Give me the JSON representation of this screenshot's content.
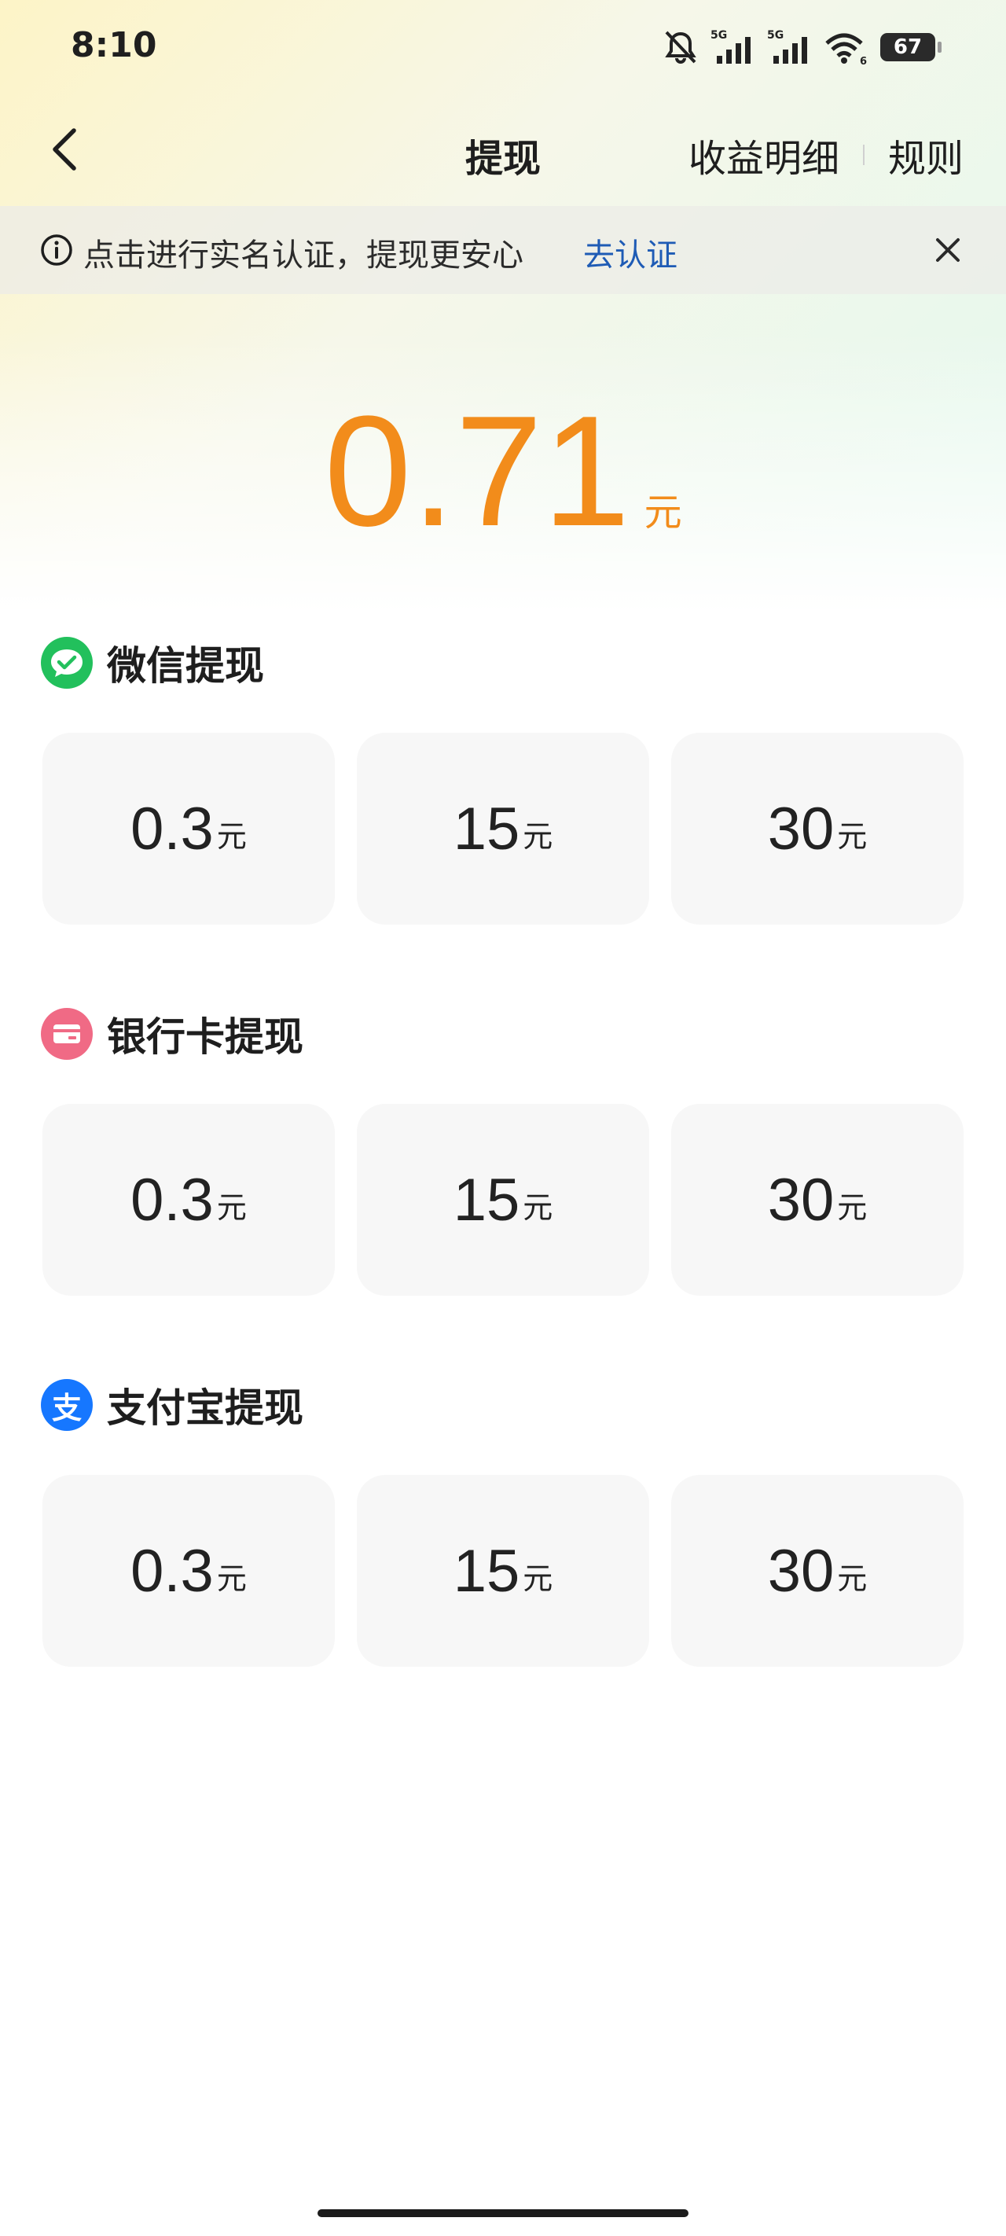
{
  "status_bar": {
    "time": "8:10",
    "signal_1_label": "5G",
    "signal_2_label": "5G",
    "wifi_label": "6",
    "battery": "67"
  },
  "nav": {
    "back_icon": "chevron-left-icon",
    "title": "提现",
    "earnings_detail": "收益明细",
    "rules": "规则"
  },
  "notice": {
    "text": "点击进行实名认证，提现更安心",
    "action": "去认证",
    "info_icon": "info-icon",
    "close_icon": "close-icon"
  },
  "balance": {
    "amount": "0.71",
    "unit": "元"
  },
  "sections": [
    {
      "title": "微信提现",
      "icon": "wechat-icon",
      "icon_color": "#22c05c",
      "options": [
        {
          "value": "0.3",
          "unit": "元"
        },
        {
          "value": "15",
          "unit": "元"
        },
        {
          "value": "30",
          "unit": "元"
        }
      ]
    },
    {
      "title": "银行卡提现",
      "icon": "bank-card-icon",
      "icon_color": "#f06a85",
      "options": [
        {
          "value": "0.3",
          "unit": "元"
        },
        {
          "value": "15",
          "unit": "元"
        },
        {
          "value": "30",
          "unit": "元"
        }
      ]
    },
    {
      "title": "支付宝提现",
      "icon": "alipay-icon",
      "icon_color": "#1677ff",
      "icon_text": "支",
      "options": [
        {
          "value": "0.3",
          "unit": "元"
        },
        {
          "value": "15",
          "unit": "元"
        },
        {
          "value": "30",
          "unit": "元"
        }
      ]
    }
  ],
  "colors": {
    "accent_orange": "#f28c1b",
    "link_blue": "#1e5bb5",
    "option_bg": "#f7f7f7"
  }
}
